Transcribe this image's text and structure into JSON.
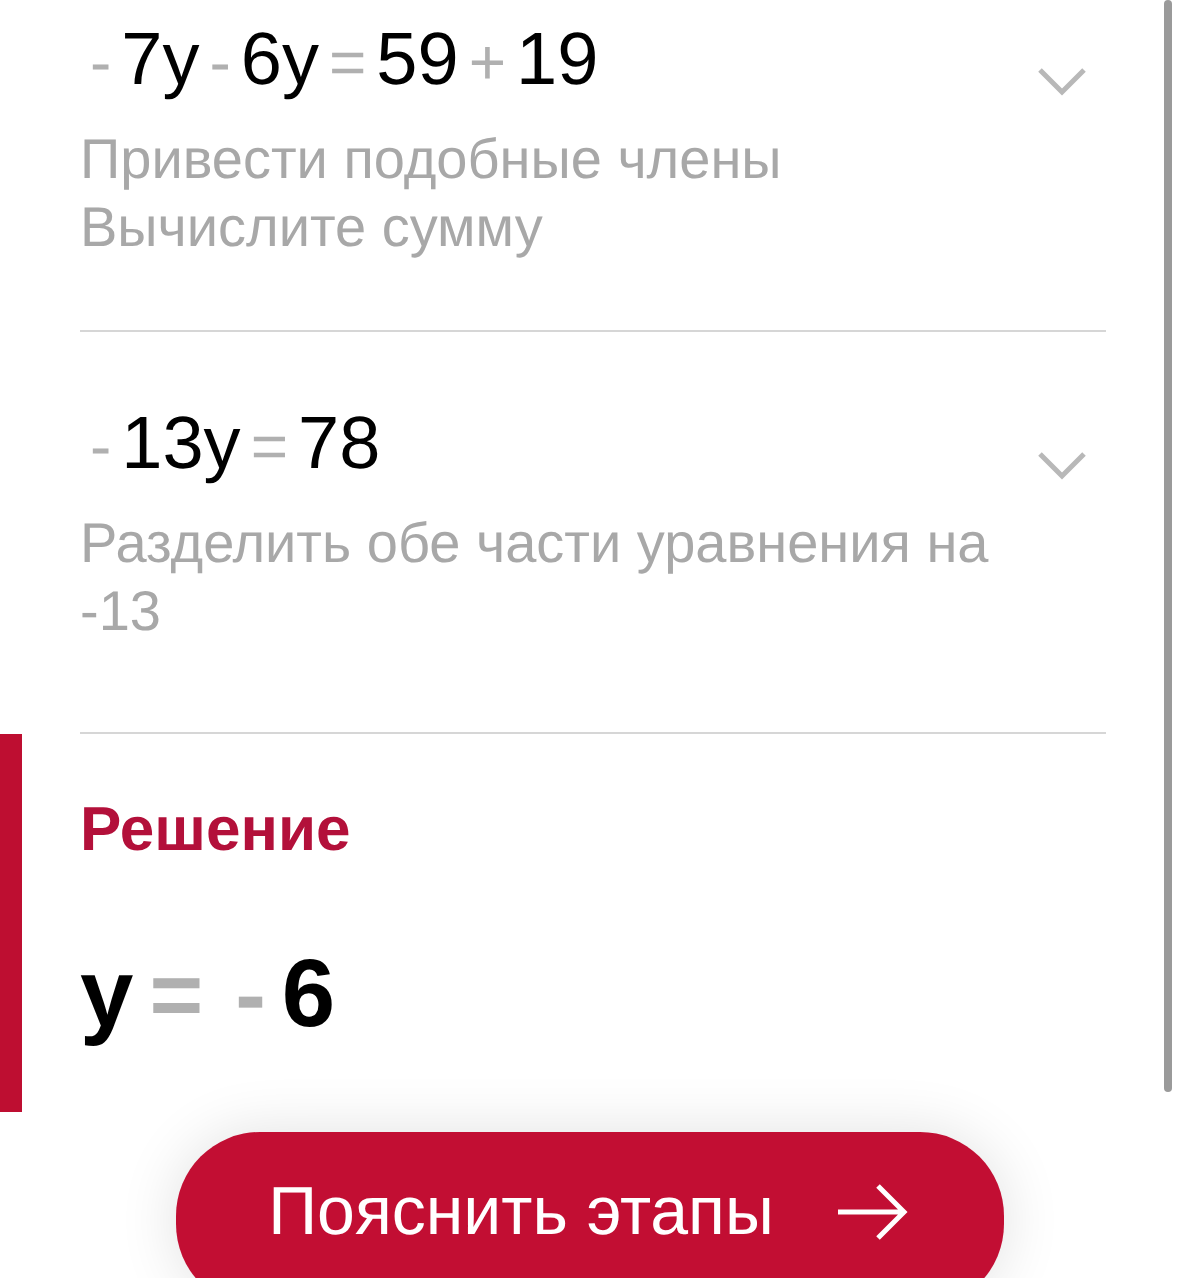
{
  "steps": [
    {
      "equation": [
        {
          "kind": "op",
          "text": "-"
        },
        {
          "kind": "term",
          "text": "7y"
        },
        {
          "kind": "op",
          "text": "-"
        },
        {
          "kind": "term",
          "text": "6y"
        },
        {
          "kind": "op",
          "text": "="
        },
        {
          "kind": "term",
          "text": "59"
        },
        {
          "kind": "op",
          "text": "+"
        },
        {
          "kind": "term",
          "text": "19"
        }
      ],
      "description": [
        "Привести подобные члены",
        "Вычислите сумму"
      ]
    },
    {
      "equation": [
        {
          "kind": "op",
          "text": "-"
        },
        {
          "kind": "term",
          "text": "13y"
        },
        {
          "kind": "op",
          "text": "="
        },
        {
          "kind": "term",
          "text": "78"
        }
      ],
      "description": [
        "Разделить обе части уравнения на -13"
      ]
    }
  ],
  "solution": {
    "label": "Решение",
    "equation": [
      {
        "kind": "term",
        "text": "y"
      },
      {
        "kind": "op",
        "text": "="
      },
      {
        "kind": "op",
        "text": "-"
      },
      {
        "kind": "term",
        "text": "6"
      }
    ]
  },
  "button": {
    "label": "Пояснить этапы"
  }
}
